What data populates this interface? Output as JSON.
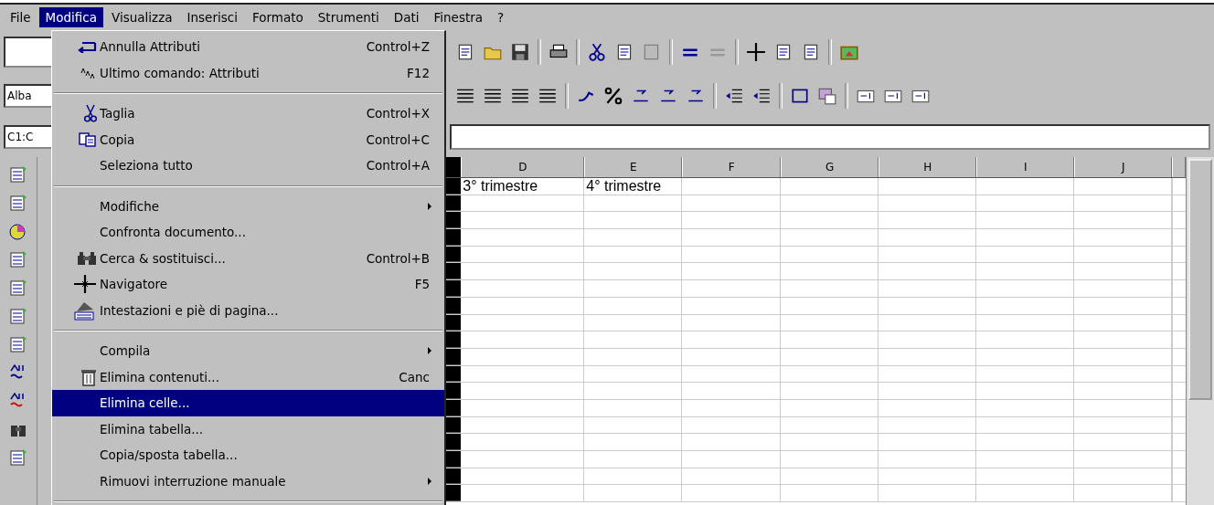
{
  "menu_bar": [
    {
      "label": "File",
      "selected": false
    },
    {
      "label": "Modifica",
      "selected": true
    },
    {
      "label": "Visualizza",
      "selected": false
    },
    {
      "label": "Inserisci",
      "selected": false
    },
    {
      "label": "Formato",
      "selected": false
    },
    {
      "label": "Strumenti",
      "selected": false
    },
    {
      "label": "Dati",
      "selected": false
    },
    {
      "label": "Finestra",
      "selected": false
    },
    {
      "label": "?",
      "selected": false
    }
  ],
  "name_box": {
    "value": "C1:C"
  },
  "font_box": {
    "value": "Alba"
  },
  "menu": [
    {
      "kind": "item",
      "label": "Annulla Attributi",
      "shortcut": "Control+Z",
      "submenu": false,
      "selected": false,
      "disabled": false
    },
    {
      "kind": "item",
      "label": "Ultimo comando: Attributi",
      "shortcut": "F12",
      "submenu": false,
      "selected": false,
      "disabled": false
    },
    {
      "kind": "separator"
    },
    {
      "kind": "item",
      "label": "Taglia",
      "shortcut": "Control+X",
      "submenu": false,
      "selected": false,
      "disabled": false
    },
    {
      "kind": "item",
      "label": "Copia",
      "shortcut": "Control+C",
      "submenu": false,
      "selected": false,
      "disabled": false
    },
    {
      "kind": "item",
      "label": "Seleziona tutto",
      "shortcut": "Control+A",
      "submenu": false,
      "selected": false,
      "disabled": false
    },
    {
      "kind": "separator"
    },
    {
      "kind": "item",
      "label": "Modifiche",
      "submenu": true,
      "selected": false,
      "disabled": false
    },
    {
      "kind": "item",
      "label": "Confronta documento...",
      "submenu": false,
      "selected": false,
      "disabled": false
    },
    {
      "kind": "item",
      "label": "Cerca & sostituisci...",
      "shortcut": "Control+B",
      "submenu": false,
      "selected": false,
      "disabled": false
    },
    {
      "kind": "item",
      "label": "Navigatore",
      "shortcut": "F5",
      "submenu": false,
      "selected": false,
      "disabled": false
    },
    {
      "kind": "item",
      "label": "Intestazioni e piè di pagina...",
      "submenu": false,
      "selected": false,
      "disabled": false
    },
    {
      "kind": "separator"
    },
    {
      "kind": "item",
      "label": "Compila",
      "submenu": true,
      "selected": false,
      "disabled": false
    },
    {
      "kind": "item",
      "label": "Elimina contenuti...",
      "shortcut": "Canc",
      "submenu": false,
      "selected": false,
      "disabled": false
    },
    {
      "kind": "item",
      "label": "Elimina celle...",
      "submenu": false,
      "selected": true,
      "disabled": false
    },
    {
      "kind": "item",
      "label": "Elimina tabella...",
      "submenu": false,
      "selected": false,
      "disabled": false
    },
    {
      "kind": "item",
      "label": "Copia/sposta tabella...",
      "submenu": false,
      "selected": false,
      "disabled": false
    },
    {
      "kind": "item",
      "label": "Rimuovi interruzione manuale",
      "submenu": true,
      "selected": false,
      "disabled": false
    },
    {
      "kind": "separator"
    }
  ],
  "sheet": {
    "columns": [
      "D",
      "E",
      "F",
      "G",
      "H",
      "I",
      "J"
    ],
    "rows": [
      [
        "3° trimestre",
        "4° trimestre"
      ]
    ]
  }
}
